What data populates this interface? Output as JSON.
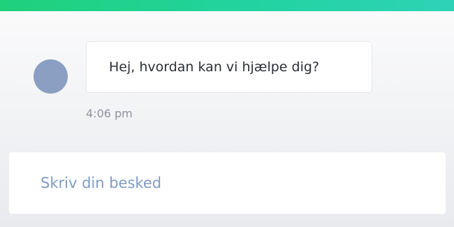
{
  "colors": {
    "header_gradient_start": "#1fd17a",
    "header_gradient_end": "#2ed3b7",
    "avatar": "#8a9fc2",
    "placeholder_text": "#7f9bc2",
    "timestamp_text": "#8f949b"
  },
  "conversation": {
    "messages": [
      {
        "sender": "agent",
        "avatar_icon": "avatar-circle",
        "text": "Hej, hvordan kan vi hjælpe dig?",
        "time": "4:06 pm"
      }
    ]
  },
  "composer": {
    "value": "",
    "placeholder": "Skriv din besked"
  }
}
